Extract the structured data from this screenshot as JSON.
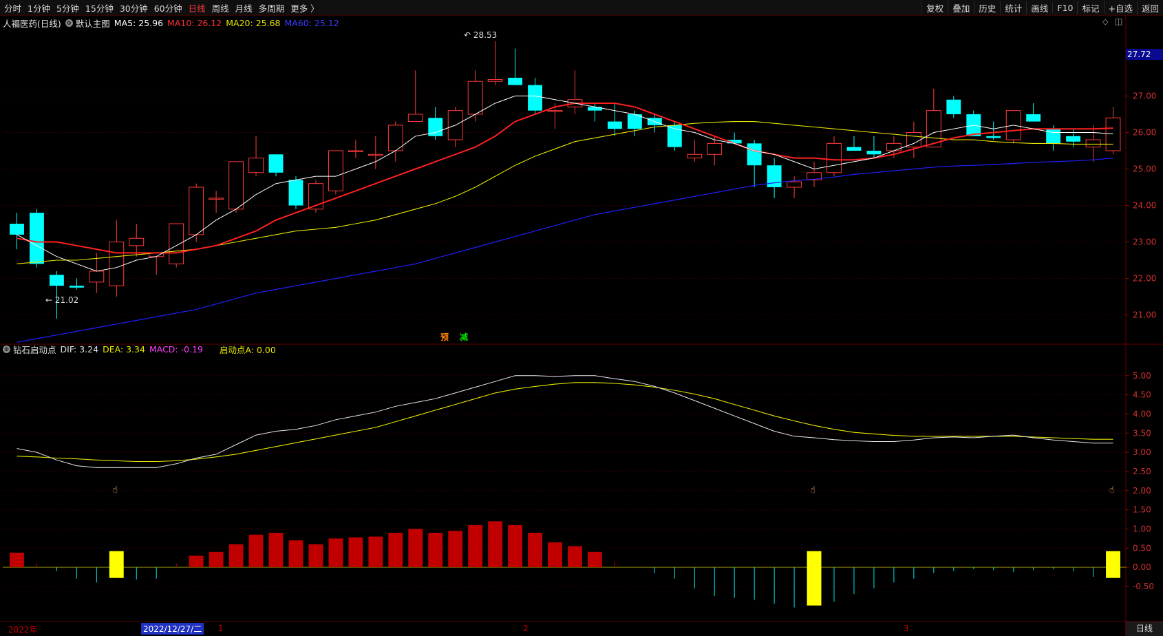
{
  "toolbar": {
    "periods": [
      "分时",
      "1分钟",
      "5分钟",
      "15分钟",
      "30分钟",
      "60分钟",
      "日线",
      "周线",
      "月线",
      "多周期",
      "更多 〉"
    ],
    "active_period": "日线",
    "tools": [
      "复权",
      "叠加",
      "历史",
      "统计",
      "画线",
      "F10",
      "标记",
      "+自选",
      "返回"
    ]
  },
  "main_legend": {
    "stock": "人福医药(日线)",
    "template": "默认主图",
    "ma5": "MA5: 25.96",
    "ma10": "MA10: 26.12",
    "ma20": "MA20: 25.68",
    "ma60": "MA60: 25.12"
  },
  "sub_legend": {
    "indicator": "钻石启动点",
    "dif": "DIF: 3.24",
    "dea": "DEA: 3.34",
    "macd": "MACD: -0.19",
    "start": "启动点A: 0.00"
  },
  "annotations": {
    "high": "28.53",
    "low": "21.02",
    "yu": "预",
    "jian": "减"
  },
  "price_badge": "27.72",
  "axis_dates": {
    "year": "2022年",
    "cursor": "2022/12/27/二",
    "m1": "1",
    "m2": "2",
    "m3": "3"
  },
  "bottom_tab": "日线",
  "colors": {
    "up": "#ff3b3b",
    "down": "#00ffff",
    "ma5": "#ffffff",
    "ma10": "#ff2020",
    "ma20": "#e6e600",
    "ma60": "#2020ff",
    "macd_pos": "#c00000",
    "macd_neg": "#00e0e0",
    "signal": "#ffff00"
  },
  "chart_data": {
    "type": "candlestick",
    "price_axis": {
      "ticks": [
        "27.00",
        "26.00",
        "25.00",
        "24.00",
        "23.00",
        "22.00",
        "21.00"
      ],
      "range": [
        20.2,
        28.8
      ]
    },
    "macd_axis": {
      "ticks": [
        "5.00",
        "4.50",
        "4.00",
        "3.50",
        "3.00",
        "2.50",
        "2.00",
        "1.50",
        "1.00",
        "0.50",
        "0.00",
        "-0.50"
      ],
      "range": [
        -1.4,
        5.5
      ]
    },
    "candles": [
      [
        23.5,
        23.8,
        22.8,
        23.2
      ],
      [
        23.8,
        23.9,
        22.3,
        22.4
      ],
      [
        22.1,
        22.2,
        20.9,
        21.8
      ],
      [
        21.8,
        22.0,
        21.7,
        21.75
      ],
      [
        21.9,
        22.7,
        21.6,
        22.2
      ],
      [
        21.8,
        23.6,
        21.5,
        23.0
      ],
      [
        22.9,
        23.5,
        22.6,
        23.1
      ],
      [
        22.6,
        22.7,
        22.1,
        22.7
      ],
      [
        22.4,
        23.5,
        22.3,
        23.5
      ],
      [
        23.2,
        24.6,
        23.0,
        24.5
      ],
      [
        24.2,
        24.4,
        23.8,
        24.2
      ],
      [
        23.9,
        25.2,
        23.8,
        25.2
      ],
      [
        24.9,
        25.9,
        24.8,
        25.3
      ],
      [
        25.4,
        25.4,
        24.8,
        24.9
      ],
      [
        24.7,
        24.8,
        23.9,
        24.0
      ],
      [
        23.9,
        24.7,
        23.8,
        24.6
      ],
      [
        24.4,
        25.5,
        24.3,
        25.5
      ],
      [
        25.5,
        25.8,
        25.3,
        25.5
      ],
      [
        25.4,
        25.9,
        25.0,
        25.4
      ],
      [
        25.5,
        26.3,
        25.2,
        26.2
      ],
      [
        26.3,
        27.7,
        26.3,
        26.5
      ],
      [
        26.4,
        26.7,
        25.8,
        25.9
      ],
      [
        25.8,
        26.7,
        25.6,
        26.6
      ],
      [
        26.5,
        27.7,
        26.3,
        27.4
      ],
      [
        27.4,
        28.5,
        27.3,
        27.45
      ],
      [
        27.5,
        28.3,
        27.3,
        27.3
      ],
      [
        27.3,
        27.5,
        26.5,
        26.6
      ],
      [
        26.6,
        26.8,
        26.1,
        26.6
      ],
      [
        26.7,
        27.7,
        26.5,
        26.9
      ],
      [
        26.7,
        26.8,
        26.3,
        26.6
      ],
      [
        26.3,
        26.8,
        25.9,
        26.1
      ],
      [
        26.5,
        26.6,
        25.9,
        26.1
      ],
      [
        26.4,
        26.5,
        26.0,
        26.2
      ],
      [
        26.2,
        26.3,
        25.5,
        25.6
      ],
      [
        25.3,
        25.8,
        25.2,
        25.4
      ],
      [
        25.4,
        25.9,
        25.1,
        25.7
      ],
      [
        25.8,
        26.0,
        25.7,
        25.7
      ],
      [
        25.7,
        25.8,
        24.5,
        25.1
      ],
      [
        25.1,
        25.3,
        24.2,
        24.5
      ],
      [
        24.5,
        24.8,
        24.2,
        24.65
      ],
      [
        24.7,
        25.2,
        24.5,
        24.9
      ],
      [
        24.9,
        25.9,
        24.8,
        25.7
      ],
      [
        25.6,
        25.9,
        25.5,
        25.5
      ],
      [
        25.5,
        25.9,
        25.3,
        25.4
      ],
      [
        25.5,
        25.9,
        25.3,
        25.7
      ],
      [
        25.6,
        26.3,
        25.3,
        26.0
      ],
      [
        25.6,
        27.2,
        25.6,
        26.6
      ],
      [
        26.9,
        27.0,
        26.4,
        26.5
      ],
      [
        26.5,
        26.6,
        25.9,
        25.9
      ],
      [
        25.9,
        26.3,
        25.8,
        25.85
      ],
      [
        25.8,
        26.6,
        25.7,
        26.6
      ],
      [
        26.5,
        26.8,
        26.3,
        26.3
      ],
      [
        26.1,
        26.2,
        25.5,
        25.7
      ],
      [
        25.9,
        26.1,
        25.6,
        25.75
      ],
      [
        25.6,
        26.2,
        25.2,
        25.8
      ],
      [
        25.5,
        26.7,
        25.4,
        26.4
      ]
    ],
    "ma5": [
      23.2,
      22.9,
      22.6,
      22.4,
      22.2,
      22.3,
      22.5,
      22.6,
      22.9,
      23.2,
      23.6,
      23.9,
      24.3,
      24.6,
      24.7,
      24.8,
      24.8,
      25.0,
      25.2,
      25.5,
      25.9,
      26.0,
      26.2,
      26.5,
      26.8,
      27.0,
      27.0,
      26.9,
      26.8,
      26.7,
      26.6,
      26.5,
      26.3,
      26.1,
      26.0,
      25.8,
      25.7,
      25.5,
      25.4,
      25.2,
      25.0,
      25.1,
      25.2,
      25.3,
      25.5,
      25.7,
      26.0,
      26.1,
      26.2,
      26.1,
      26.2,
      26.1,
      26.0,
      26.0,
      26.0,
      25.96
    ],
    "ma10": [
      23.1,
      23.0,
      23.0,
      22.9,
      22.8,
      22.7,
      22.7,
      22.7,
      22.7,
      22.8,
      22.9,
      23.1,
      23.3,
      23.6,
      23.8,
      24.0,
      24.2,
      24.4,
      24.6,
      24.8,
      25.0,
      25.2,
      25.4,
      25.6,
      25.9,
      26.3,
      26.5,
      26.7,
      26.8,
      26.8,
      26.8,
      26.7,
      26.5,
      26.3,
      26.1,
      25.9,
      25.7,
      25.5,
      25.4,
      25.3,
      25.3,
      25.25,
      25.25,
      25.3,
      25.4,
      25.55,
      25.7,
      25.85,
      25.95,
      26.0,
      26.05,
      26.1,
      26.1,
      26.1,
      26.1,
      26.12
    ],
    "ma20": [
      22.4,
      22.45,
      22.5,
      22.5,
      22.55,
      22.6,
      22.65,
      22.7,
      22.75,
      22.8,
      22.9,
      23.0,
      23.1,
      23.2,
      23.3,
      23.35,
      23.4,
      23.5,
      23.6,
      23.75,
      23.9,
      24.05,
      24.25,
      24.5,
      24.8,
      25.1,
      25.35,
      25.55,
      25.75,
      25.85,
      25.95,
      26.05,
      26.15,
      26.2,
      26.25,
      26.28,
      26.3,
      26.3,
      26.25,
      26.2,
      26.15,
      26.1,
      26.05,
      26.0,
      25.95,
      25.9,
      25.85,
      25.8,
      25.8,
      25.75,
      25.72,
      25.7,
      25.7,
      25.68,
      25.68,
      25.68
    ],
    "ma60": [
      20.25,
      20.35,
      20.45,
      20.55,
      20.65,
      20.75,
      20.85,
      20.95,
      21.05,
      21.15,
      21.3,
      21.45,
      21.6,
      21.7,
      21.8,
      21.9,
      22.0,
      22.1,
      22.2,
      22.3,
      22.4,
      22.55,
      22.7,
      22.85,
      23.0,
      23.15,
      23.3,
      23.45,
      23.6,
      23.75,
      23.85,
      23.95,
      24.05,
      24.15,
      24.25,
      24.35,
      24.45,
      24.55,
      24.62,
      24.68,
      24.72,
      24.78,
      24.85,
      24.9,
      24.95,
      25.0,
      25.05,
      25.08,
      25.1,
      25.12,
      25.15,
      25.18,
      25.2,
      25.22,
      25.25,
      25.3
    ],
    "dif": [
      3.1,
      3.0,
      2.8,
      2.65,
      2.6,
      2.6,
      2.6,
      2.6,
      2.7,
      2.85,
      2.95,
      3.2,
      3.45,
      3.55,
      3.6,
      3.7,
      3.85,
      3.95,
      4.05,
      4.2,
      4.3,
      4.4,
      4.55,
      4.7,
      4.85,
      5.0,
      5.0,
      4.98,
      5.0,
      5.0,
      4.92,
      4.85,
      4.72,
      4.55,
      4.35,
      4.15,
      3.95,
      3.75,
      3.55,
      3.42,
      3.38,
      3.33,
      3.3,
      3.28,
      3.28,
      3.32,
      3.38,
      3.4,
      3.38,
      3.42,
      3.45,
      3.38,
      3.32,
      3.28,
      3.24,
      3.24
    ],
    "dea": [
      2.9,
      2.88,
      2.85,
      2.83,
      2.8,
      2.78,
      2.76,
      2.76,
      2.78,
      2.82,
      2.88,
      2.95,
      3.05,
      3.15,
      3.25,
      3.35,
      3.45,
      3.55,
      3.65,
      3.8,
      3.95,
      4.1,
      4.25,
      4.4,
      4.55,
      4.65,
      4.72,
      4.78,
      4.82,
      4.82,
      4.8,
      4.76,
      4.7,
      4.62,
      4.52,
      4.4,
      4.25,
      4.1,
      3.95,
      3.82,
      3.7,
      3.6,
      3.52,
      3.48,
      3.44,
      3.42,
      3.42,
      3.42,
      3.42,
      3.42,
      3.42,
      3.4,
      3.38,
      3.36,
      3.34,
      3.34
    ],
    "macd": [
      0.38,
      0.1,
      -0.1,
      -0.3,
      -0.4,
      -0.35,
      -0.32,
      -0.3,
      0.1,
      0.3,
      0.4,
      0.6,
      0.85,
      0.9,
      0.7,
      0.6,
      0.75,
      0.78,
      0.8,
      0.9,
      1.0,
      0.9,
      0.95,
      1.1,
      1.2,
      1.1,
      0.9,
      0.65,
      0.55,
      0.4,
      0.15,
      0.0,
      -0.15,
      -0.3,
      -0.55,
      -0.75,
      -0.8,
      -0.85,
      -0.95,
      -1.05,
      -1.1,
      -0.9,
      -0.7,
      -0.55,
      -0.4,
      -0.3,
      -0.15,
      -0.1,
      -0.05,
      -0.08,
      -0.12,
      -0.08,
      -0.05,
      -0.1,
      -0.25,
      -0.19
    ],
    "signals": [
      5,
      40,
      55
    ]
  }
}
